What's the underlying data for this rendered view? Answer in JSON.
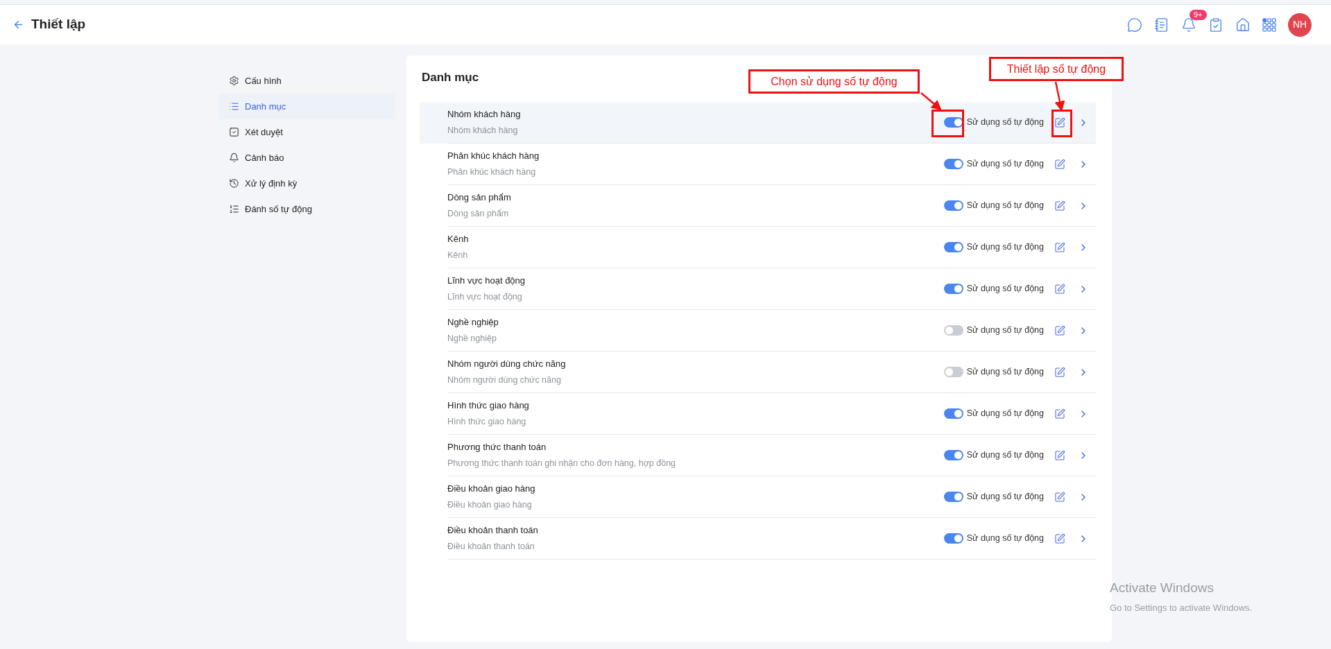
{
  "header": {
    "title": "Thiết lập",
    "notification_badge": "9+",
    "avatar": "NH"
  },
  "sidebar": {
    "items": [
      {
        "label": "Cấu hình",
        "selected": false
      },
      {
        "label": "Danh mục",
        "selected": true
      },
      {
        "label": "Xét duyệt",
        "selected": false
      },
      {
        "label": "Cảnh báo",
        "selected": false
      },
      {
        "label": "Xử lý định kỳ",
        "selected": false
      },
      {
        "label": "Đánh số tự động",
        "selected": false
      }
    ]
  },
  "panel": {
    "title": "Danh mục",
    "rows": [
      {
        "title": "Nhóm khách hàng",
        "subtitle": "Nhóm khách hàng",
        "auto_number": true,
        "toggle_label": "Sử dụng số tự động",
        "selected": true
      },
      {
        "title": "Phân khúc khách hàng",
        "subtitle": "Phân khúc khách hàng",
        "auto_number": true,
        "toggle_label": "Sử dụng số tự động",
        "selected": false
      },
      {
        "title": "Dòng sản phẩm",
        "subtitle": "Dòng sản phẩm",
        "auto_number": true,
        "toggle_label": "Sử dụng số tự động",
        "selected": false
      },
      {
        "title": "Kênh",
        "subtitle": "Kênh",
        "auto_number": true,
        "toggle_label": "Sử dụng số tự động",
        "selected": false
      },
      {
        "title": "Lĩnh vực hoạt động",
        "subtitle": "Lĩnh vực hoạt động",
        "auto_number": true,
        "toggle_label": "Sử dụng số tự động",
        "selected": false
      },
      {
        "title": "Nghề nghiệp",
        "subtitle": "Nghề nghiệp",
        "auto_number": false,
        "toggle_label": "Sử dụng số tự động",
        "selected": false
      },
      {
        "title": "Nhóm người dùng chức năng",
        "subtitle": "Nhóm người dùng chức năng",
        "auto_number": false,
        "toggle_label": "Sử dụng số tự động",
        "selected": false
      },
      {
        "title": "Hình thức giao hàng",
        "subtitle": "Hình thức giao hàng",
        "auto_number": true,
        "toggle_label": "Sử dụng số tự động",
        "selected": false
      },
      {
        "title": "Phương thức thanh toán",
        "subtitle": "Phương thức thanh toán ghi nhận cho đơn hàng, hợp đồng",
        "auto_number": true,
        "toggle_label": "Sử dụng số tự động",
        "selected": false
      },
      {
        "title": "Điều khoản giao hàng",
        "subtitle": "Điều khoản giao hàng",
        "auto_number": true,
        "toggle_label": "Sử dụng số tự động",
        "selected": false
      },
      {
        "title": "Điều khoản thanh toán",
        "subtitle": "Điều khoản thanh toán",
        "auto_number": true,
        "toggle_label": "Sử dụng số tự động",
        "selected": false
      }
    ]
  },
  "annotations": [
    {
      "text": "Chọn sử dụng số tự động"
    },
    {
      "text": "Thiết lập số tự động"
    }
  ],
  "os_notice": {
    "title": "Activate Windows",
    "message": "Go to Settings to activate Windows."
  }
}
